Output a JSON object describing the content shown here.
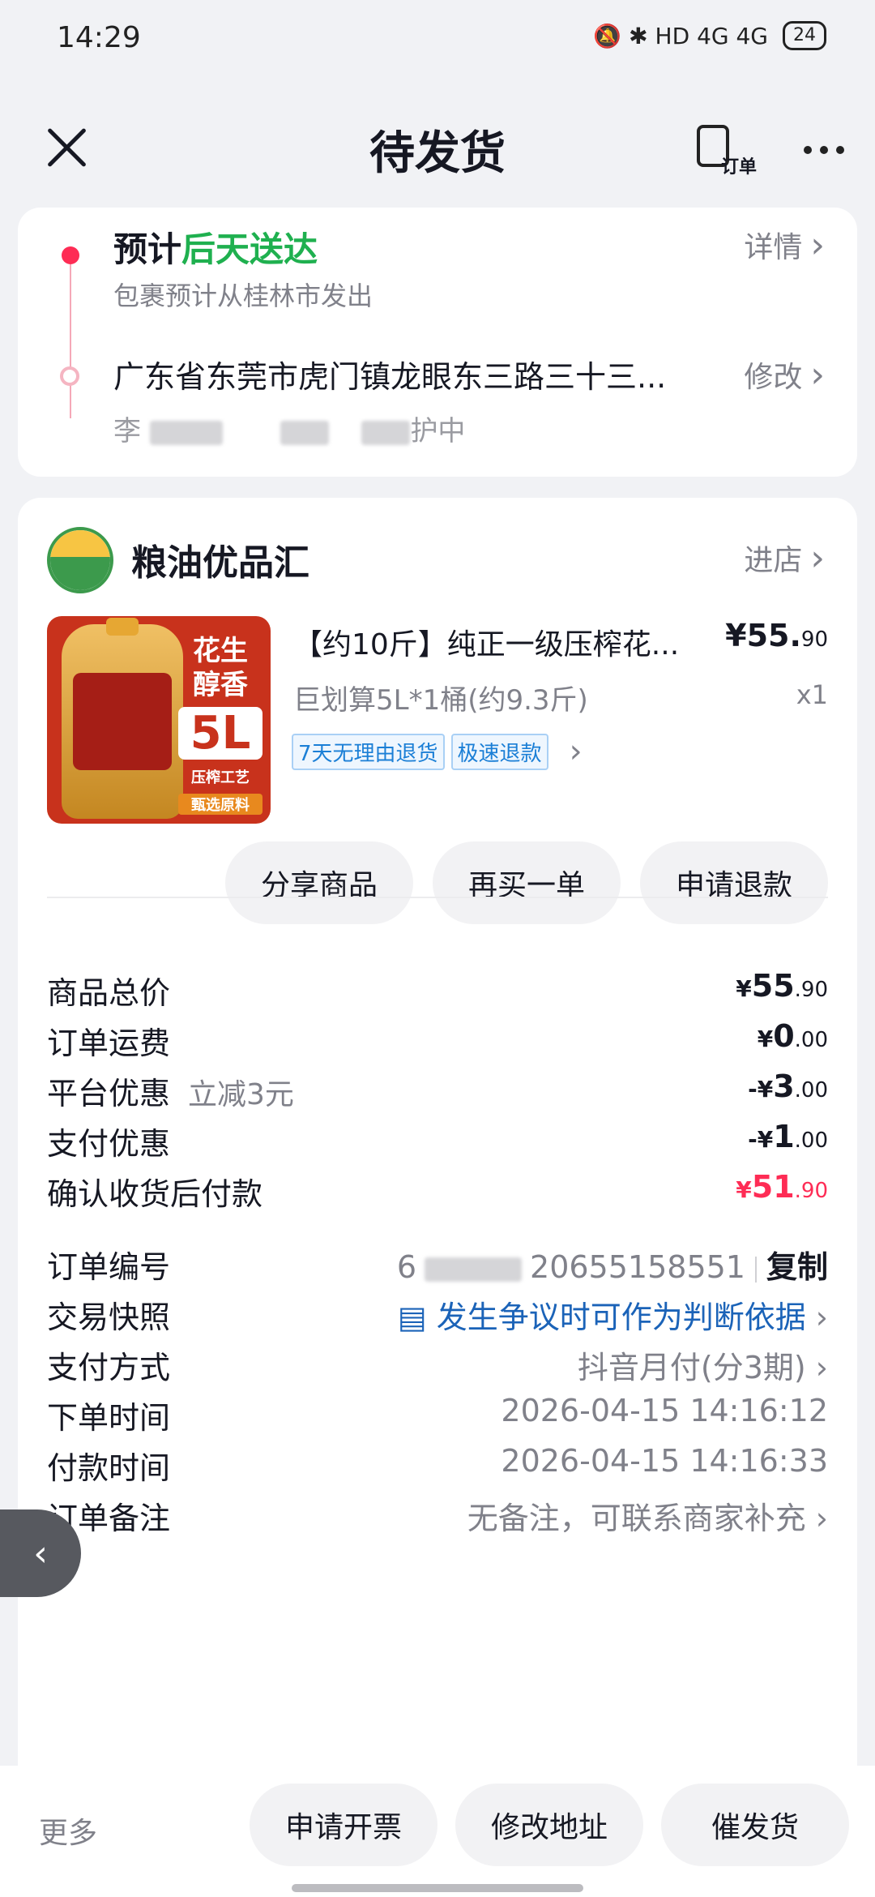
{
  "status": {
    "time": "14:29",
    "icons": "🔕 ✱ HD 4G 4G",
    "battery": "24"
  },
  "header": {
    "title": "待发货",
    "order_label": "订单"
  },
  "delivery": {
    "eta_prefix": "预计",
    "eta_day": "后天送达",
    "detail": "详情",
    "from": "包裹预计从桂林市发出",
    "address": "广东省东莞市虎门镇龙眼东三路三十三...",
    "modify": "修改",
    "recipient_initial": "李",
    "privacy": "护中"
  },
  "shop": {
    "name": "粮油优品汇",
    "enter": "进店"
  },
  "product": {
    "name": "【约10斤】纯正一级压榨花...",
    "price_main": "¥55.",
    "price_cents": "90",
    "spec": "巨划算5L*1桶(约9.3斤)",
    "qty": "x1",
    "badges": [
      "7天无理由退货",
      "极速退款"
    ],
    "thumb_tag": {
      "line1": "花生",
      "line2": "醇香",
      "size": "5L",
      "craft": "压榨工艺",
      "select": "甄选原料"
    }
  },
  "actions": [
    "分享商品",
    "再买一单",
    "申请退款"
  ],
  "price_rows": [
    {
      "label": "商品总价",
      "note": "",
      "sign": "",
      "main": "55",
      "cents": ".90"
    },
    {
      "label": "订单运费",
      "note": "",
      "sign": "",
      "main": "0",
      "cents": ".00"
    },
    {
      "label": "平台优惠",
      "note": "立减3元",
      "sign": "-",
      "main": "3",
      "cents": ".00"
    },
    {
      "label": "支付优惠",
      "note": "",
      "sign": "-",
      "main": "1",
      "cents": ".00"
    },
    {
      "label": "确认收货后付款",
      "note": "",
      "sign": "",
      "main": "51",
      "cents": ".90"
    }
  ],
  "info": {
    "order_no_label": "订单编号",
    "order_no_prefix": "6",
    "order_no_suffix": "20655158551",
    "copy": "复制",
    "snapshot_label": "交易快照",
    "snapshot_value": "发生争议时可作为判断依据",
    "pay_method_label": "支付方式",
    "pay_method_value": "抖音月付(分3期)",
    "order_time_label": "下单时间",
    "order_time_value": "2026-04-15 14:16:12",
    "pay_time_label": "付款时间",
    "pay_time_value": "2026-04-15 14:16:33",
    "remark_label": "订单备注",
    "remark_value": "无备注，可联系商家补充"
  },
  "bottom": {
    "more": "更多",
    "buttons": [
      "申请开票",
      "修改地址",
      "催发货"
    ]
  },
  "colors": {
    "accent_red": "#fe2c55",
    "eta_green": "#1fb04f",
    "link_blue": "#1b63b8"
  }
}
